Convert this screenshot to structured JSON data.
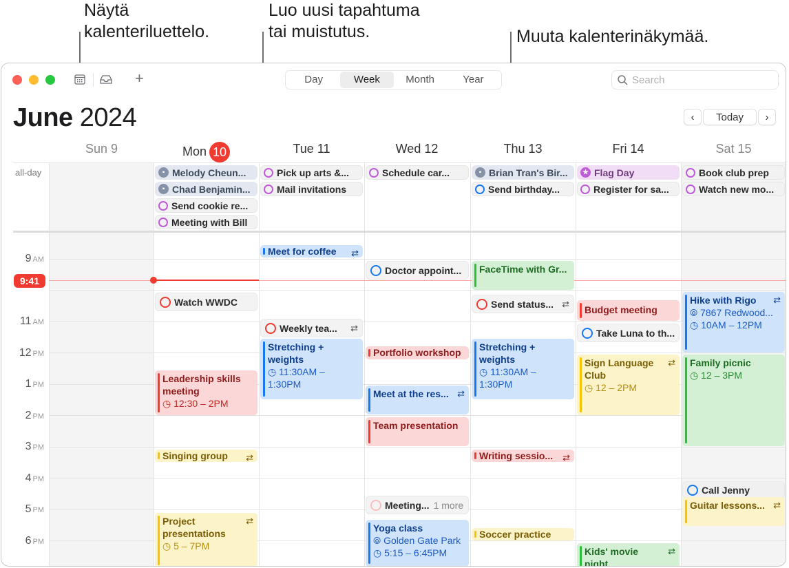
{
  "callouts": {
    "calendar_list": "Näytä\nkalenteriluettelo.",
    "new_event": "Luo uusi tapahtuma\ntai muistutus.",
    "change_view": "Muuta kalenterinäkymää."
  },
  "toolbar": {
    "views": [
      "Day",
      "Week",
      "Month",
      "Year"
    ],
    "active_view": "Week",
    "search_placeholder": "Search",
    "add_label": "+"
  },
  "header": {
    "month": "June",
    "year": "2024",
    "today_button": "Today",
    "prev": "‹",
    "next": "›"
  },
  "days": [
    {
      "label": "Sun 9",
      "weekend": true
    },
    {
      "label": "Mon",
      "badge": "10",
      "today": true
    },
    {
      "label": "Tue 11"
    },
    {
      "label": "Wed 12"
    },
    {
      "label": "Thu 13"
    },
    {
      "label": "Fri 14"
    },
    {
      "label": "Sat 15",
      "weekend": true
    }
  ],
  "allday_label": "all-day",
  "allday": {
    "mon": [
      "Melody Cheun...",
      "Chad Benjamin...",
      "Send cookie re...",
      "Meeting with Bill"
    ],
    "tue": [
      "Pick up arts &...",
      "Mail invitations"
    ],
    "wed": [
      "Schedule car..."
    ],
    "thu": [
      "Brian Tran's Bir...",
      "Send birthday..."
    ],
    "fri": [
      "Flag Day",
      "Register for sa..."
    ],
    "sat": [
      "Book club prep",
      "Watch new mo..."
    ]
  },
  "hours": [
    {
      "h": "9",
      "p": "AM"
    },
    {
      "h": "11",
      "p": "AM"
    },
    {
      "h": "12",
      "p": "PM"
    },
    {
      "h": "1",
      "p": "PM"
    },
    {
      "h": "2",
      "p": "PM"
    },
    {
      "h": "3",
      "p": "PM"
    },
    {
      "h": "4",
      "p": "PM"
    },
    {
      "h": "5",
      "p": "PM"
    },
    {
      "h": "6",
      "p": "PM"
    }
  ],
  "now": "9:41",
  "events": {
    "watch_wwdc": "Watch WWDC",
    "leadership": {
      "title": "Leadership skills meeting",
      "time": "◷ 12:30 – 2PM"
    },
    "singing": "Singing group",
    "project": {
      "title": "Project presentations",
      "time": "◷ 5 – 7PM"
    },
    "coffee": "Meet for coffee",
    "weekly": "Weekly tea...",
    "stretch_tue": {
      "title": "Stretching + weights",
      "time": "◷ 11:30AM – 1:30PM"
    },
    "doctor": "Doctor appoint...",
    "portfolio": "Portfolio workshop",
    "meet_res": "Meet at the res...",
    "team": "Team presentation",
    "meeting_more": {
      "title": "Meeting...",
      "more": "1 more"
    },
    "yoga": {
      "title": "Yoga class",
      "loc": "⦾ Golden Gate Park",
      "time": "◷ 5:15 – 6:45PM"
    },
    "facetime": "FaceTime with Gr...",
    "send_status": "Send status...",
    "stretch_thu": {
      "title": "Stretching + weights",
      "time": "◷ 11:30AM – 1:30PM"
    },
    "writing": "Writing sessio...",
    "soccer": "Soccer practice",
    "budget": "Budget meeting",
    "luna": "Take Luna to th...",
    "sign": {
      "title": "Sign Language Club",
      "time": "◷ 12 – 2PM"
    },
    "kids": {
      "title": "Kids' movie night"
    },
    "hike": {
      "title": "Hike with Rigo",
      "loc": "⦾ 7867 Redwood...",
      "time": "◷ 10AM – 12PM"
    },
    "picnic": {
      "title": "Family picnic",
      "time": "◷ 12 – 3PM"
    },
    "call_jenny": "Call Jenny",
    "guitar": "Guitar lessons..."
  },
  "repeat_glyph": "⇄"
}
